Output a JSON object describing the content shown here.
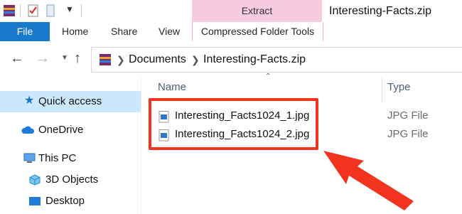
{
  "titlebar": {
    "context_tab": "Extract",
    "window_title": "Interesting-Facts.zip"
  },
  "ribbon": {
    "tabs": [
      "File",
      "Home",
      "Share",
      "View"
    ],
    "context_tool": "Compressed Folder Tools"
  },
  "address_bar": {
    "breadcrumbs": [
      "Documents",
      "Interesting-Facts.zip"
    ]
  },
  "nav_pane": {
    "items": [
      "Quick access",
      "OneDrive",
      "This PC",
      "3D Objects",
      "Desktop"
    ],
    "selected": "Quick access"
  },
  "file_list": {
    "columns": [
      "Name",
      "Type"
    ],
    "rows": [
      {
        "name": "Interesting_Facts1024_1.jpg",
        "type": "JPG File"
      },
      {
        "name": "Interesting_Facts1024_2.jpg",
        "type": "JPG File"
      }
    ]
  },
  "colors": {
    "file_tab": "#1979ca",
    "context_tab": "#f7cbe0",
    "selection": "#cce8ff",
    "annotation": "#f2331e"
  }
}
